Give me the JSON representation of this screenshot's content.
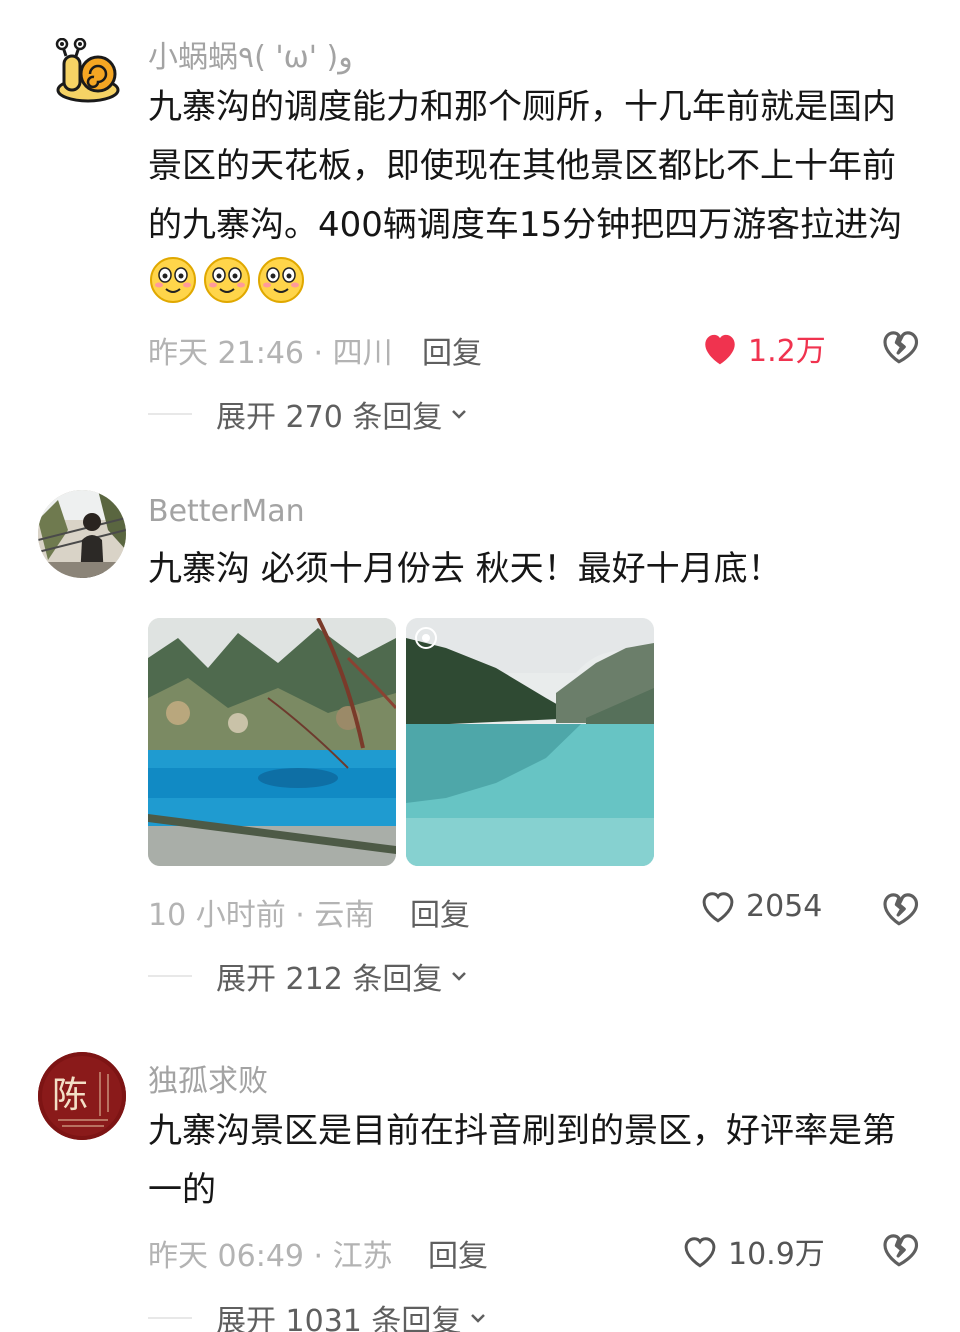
{
  "comments": [
    {
      "username": "小蜗蜗٩( 'ω' )و",
      "text": "九寨沟的调度能力和那个厕所，十几年前就是国内景区的天花板，即使现在其他景区都比不上十年前的九寨沟。400辆调度车15分钟把四万游客拉进沟",
      "emojis": [
        "smiley-emoji",
        "smiley-emoji",
        "smiley-emoji"
      ],
      "time_location": "昨天 21:46 · 四川",
      "reply_label": "回复",
      "likes": "1.2万",
      "liked": true,
      "expand_label": "展开 270 条回复"
    },
    {
      "username": "BetterMan",
      "text": "九寨沟 必须十月份去 秋天！最好十月底！",
      "images": [
        "lake-photo-autumn",
        "lake-photo-mountain"
      ],
      "time_location": "10 小时前 · 云南",
      "reply_label": "回复",
      "likes": "2054",
      "liked": false,
      "expand_label": "展开 212 条回复"
    },
    {
      "username": "独孤求败",
      "avatar_text": "陈",
      "text": "九寨沟景区是目前在抖音刷到的景区，好评率是第一的",
      "time_location": "昨天 06:49 · 江苏",
      "reply_label": "回复",
      "likes": "10.9万",
      "liked": false,
      "expand_label": "展开 1031 条回复"
    }
  ],
  "colors": {
    "like_active": "#f0334f",
    "meta_gray": "#b3b3b3",
    "text": "#161616"
  }
}
